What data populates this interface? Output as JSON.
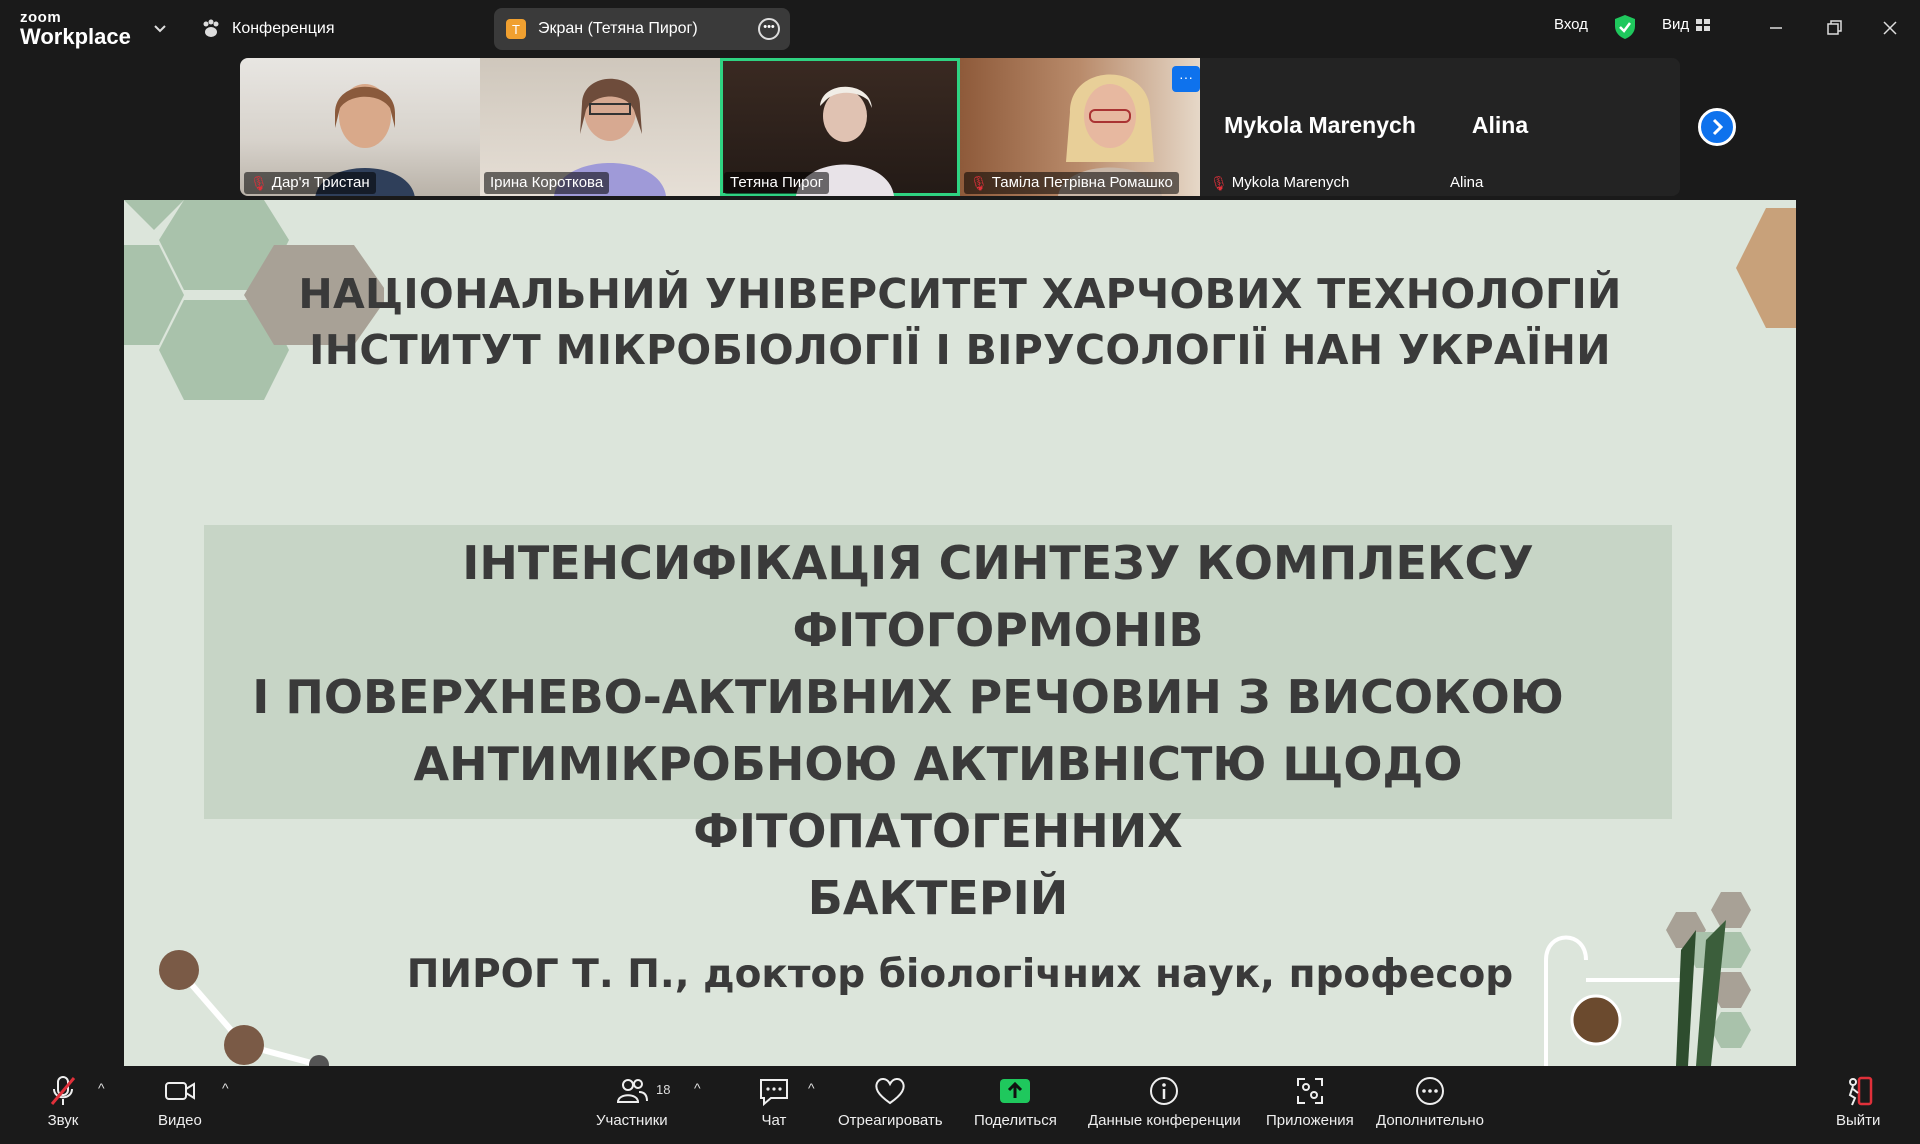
{
  "app": {
    "logo_small": "zoom",
    "logo_big": "Workplace",
    "meeting_label": "Конференция",
    "screen_share_label": "Экран (Тетяна Пирог)",
    "screen_share_avatar": "T",
    "signin_label": "Вход",
    "view_label": "Вид"
  },
  "participants": [
    {
      "name": "Дар'я Тристан",
      "muted": true
    },
    {
      "name": "Ірина Короткова",
      "muted": false
    },
    {
      "name": "Тетяна Пирог",
      "muted": false,
      "active": true
    },
    {
      "name": "Таміла Петрівна Ромашко",
      "muted": true
    },
    {
      "name": "Mykola Marenych",
      "muted": true,
      "display": "Mykola Marenych"
    },
    {
      "name": "Alina",
      "muted": false,
      "display": "Alina"
    }
  ],
  "slide": {
    "univ_line1": "НАЦІОНАЛЬНИЙ УНІВЕРСИТЕТ ХАРЧОВИХ ТЕХНОЛОГІЙ",
    "univ_line2": "ІНСТИТУТ МІКРОБІОЛОГІЇ І ВІРУСОЛОГІЇ НАН УКРАЇНИ",
    "topic_line1": "ІНТЕНСИФІКАЦІЯ СИНТЕЗУ КОМПЛЕКСУ ФІТОГОРМОНІВ",
    "topic_line2": "І ПОВЕРХНЕВО-АКТИВНИХ РЕЧОВИН З ВИСОКОЮ",
    "topic_line3": "АНТИМІКРОБНОЮ АКТИВНІСТЮ ЩОДО ФІТОПАТОГЕННИХ",
    "topic_line4": "БАКТЕРІЙ",
    "author": "ПИРОГ Т. П., доктор біологічних наук, професор"
  },
  "toolbar": {
    "audio": "Звук",
    "video": "Видео",
    "participants": "Участники",
    "participants_count": "18",
    "chat": "Чат",
    "react": "Отреагировать",
    "share": "Поделиться",
    "info": "Данные конференции",
    "apps": "Приложения",
    "more": "Дополнительно",
    "leave": "Выйти"
  },
  "colors": {
    "accent": "#0e72ed",
    "active_speaker": "#2fd382",
    "share_green": "#1fc85d",
    "leave_red": "#e0303a",
    "slide_bg": "#dce5db"
  }
}
